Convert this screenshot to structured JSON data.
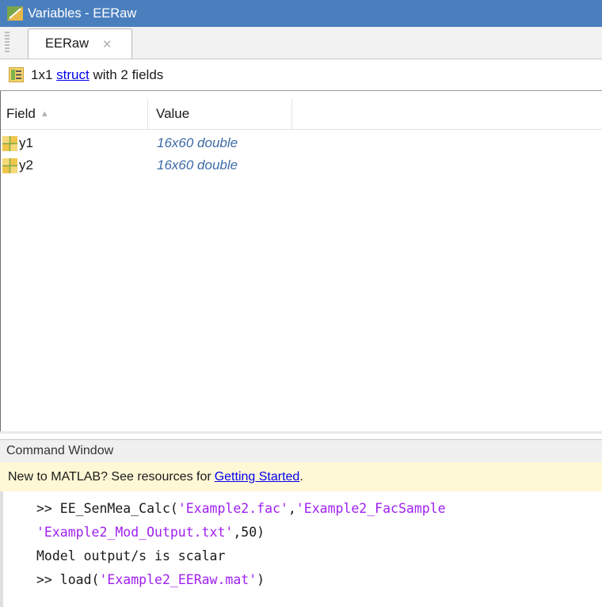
{
  "variables_panel": {
    "title": "Variables - EERaw",
    "tab_label": "EERaw",
    "tab_close": "✕",
    "info": {
      "size_prefix": "1x1",
      "type_link": "struct",
      "suffix": "with 2 fields"
    },
    "columns": {
      "field": "Field",
      "value": "Value"
    },
    "rows": [
      {
        "field": "y1",
        "value": "16x60 double"
      },
      {
        "field": "y2",
        "value": "16x60 double"
      }
    ]
  },
  "command_window": {
    "title": "Command Window",
    "new_prompt": "New to MATLAB? See resources for",
    "getting_started_link": "Getting Started",
    "period": ".",
    "lines": [
      {
        "parts": [
          {
            "t": ">> EE_SenMea_Calc(",
            "s": false
          },
          {
            "t": "'Example2.fac'",
            "s": true
          },
          {
            "t": ",",
            "s": false
          },
          {
            "t": "'Example2_FacSample",
            "s": true
          }
        ]
      },
      {
        "parts": [
          {
            "t": "'Example2_Mod_Output.txt'",
            "s": true
          },
          {
            "t": ",50)",
            "s": false
          }
        ]
      },
      {
        "parts": [
          {
            "t": "Model output/s is scalar",
            "s": false
          }
        ]
      },
      {
        "parts": [
          {
            "t": ">> load(",
            "s": false
          },
          {
            "t": "'Example2_EERaw.mat'",
            "s": true
          },
          {
            "t": ")",
            "s": false
          }
        ]
      }
    ]
  },
  "colors": {
    "titlebar": "#4a7fbe",
    "string_literal": "#a020f0",
    "value_text": "#3d6aa6",
    "notice_background": "#fff8d6",
    "link": "#0000ee"
  },
  "icons": [
    "variables-editor-icon",
    "struct-icon",
    "sort-ascending-icon",
    "array-icon",
    "close-icon"
  ]
}
